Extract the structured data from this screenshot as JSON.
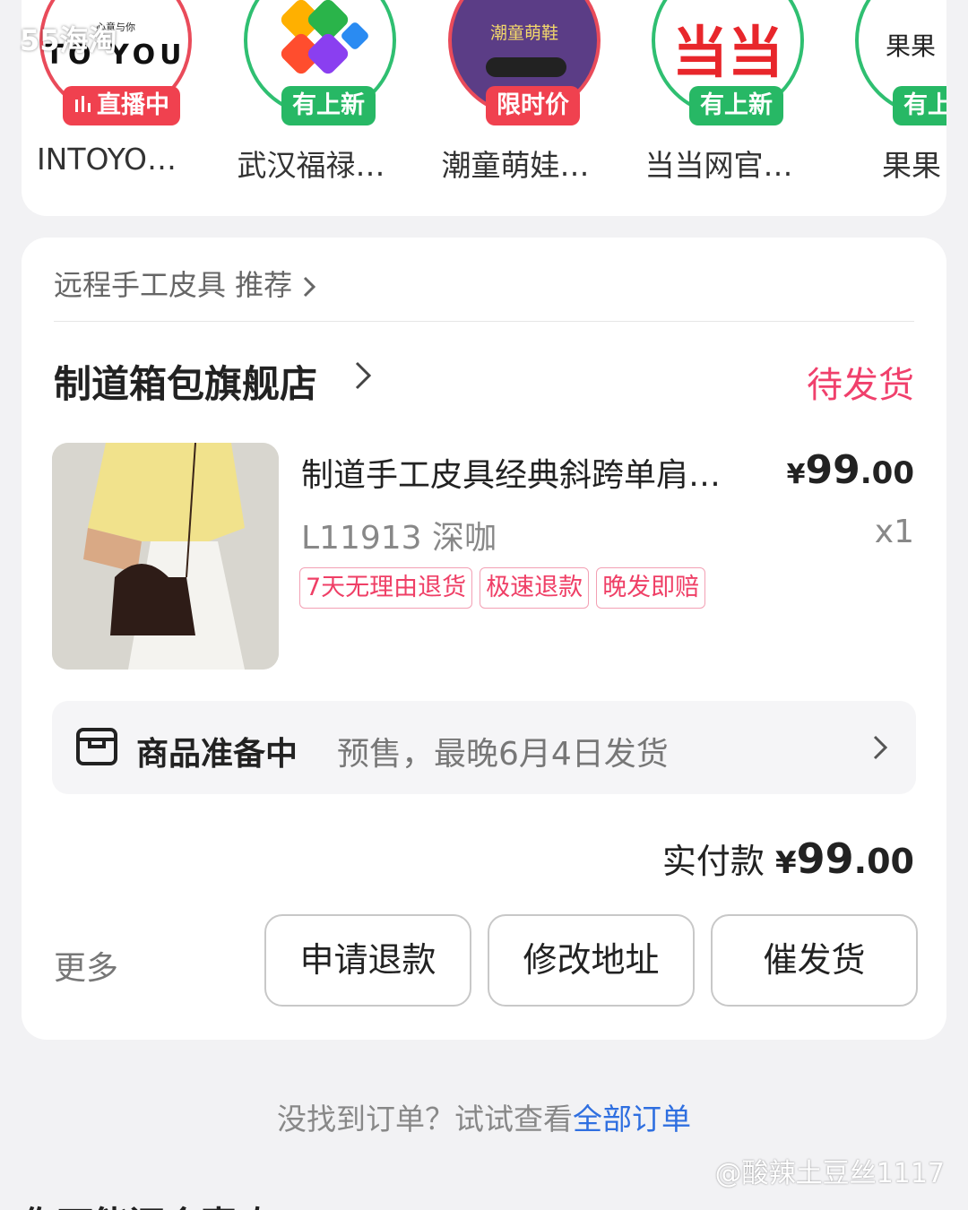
{
  "site_mark": "55海淘",
  "stores": [
    {
      "name": "INTOYO…",
      "badge": "直播中",
      "badge_color": "red",
      "logo_text_top": "心意与你",
      "logo_text": "TO YOU"
    },
    {
      "name": "武汉福禄…",
      "badge": "有上新",
      "badge_color": "green"
    },
    {
      "name": "潮童萌娃…",
      "badge": "限时价",
      "badge_color": "red",
      "logo_text": "潮童萌鞋"
    },
    {
      "name": "当当网官…",
      "badge": "有上新",
      "badge_color": "green",
      "logo_text": "当当"
    },
    {
      "name": "果果",
      "badge": "有上新",
      "badge_color": "green",
      "logo_text": "果果"
    }
  ],
  "order": {
    "recommend_label": "远程手工皮具 推荐",
    "shop_name": "制道箱包旗舰店",
    "status": "待发货",
    "product": {
      "title": "制道手工皮具经典斜跨单肩…",
      "price_symbol": "¥",
      "price_int": "99",
      "price_dec": ".00",
      "sku": "L11913 深咖",
      "qty": "x1",
      "tags": [
        "7天无理由退货",
        "极速退款",
        "晚发即赔"
      ]
    },
    "prep": {
      "title": "商品准备中",
      "desc": "预售，最晚6月4日发货"
    },
    "paid_label": "实付款",
    "paid_symbol": "¥",
    "paid_int": "99",
    "paid_dec": ".00",
    "more_label": "更多",
    "actions": [
      "申请退款",
      "修改地址",
      "催发货"
    ]
  },
  "hint": {
    "text": "没找到订单？试试查看",
    "link": "全部订单"
  },
  "watermark": "@酸辣土豆丝1117",
  "bottom_cut_text": "你可能还会喜欢",
  "colors": {
    "accent_pink": "#f0406c",
    "link_blue": "#2f6fe0",
    "badge_red": "#f0414f",
    "badge_green": "#27b865"
  }
}
